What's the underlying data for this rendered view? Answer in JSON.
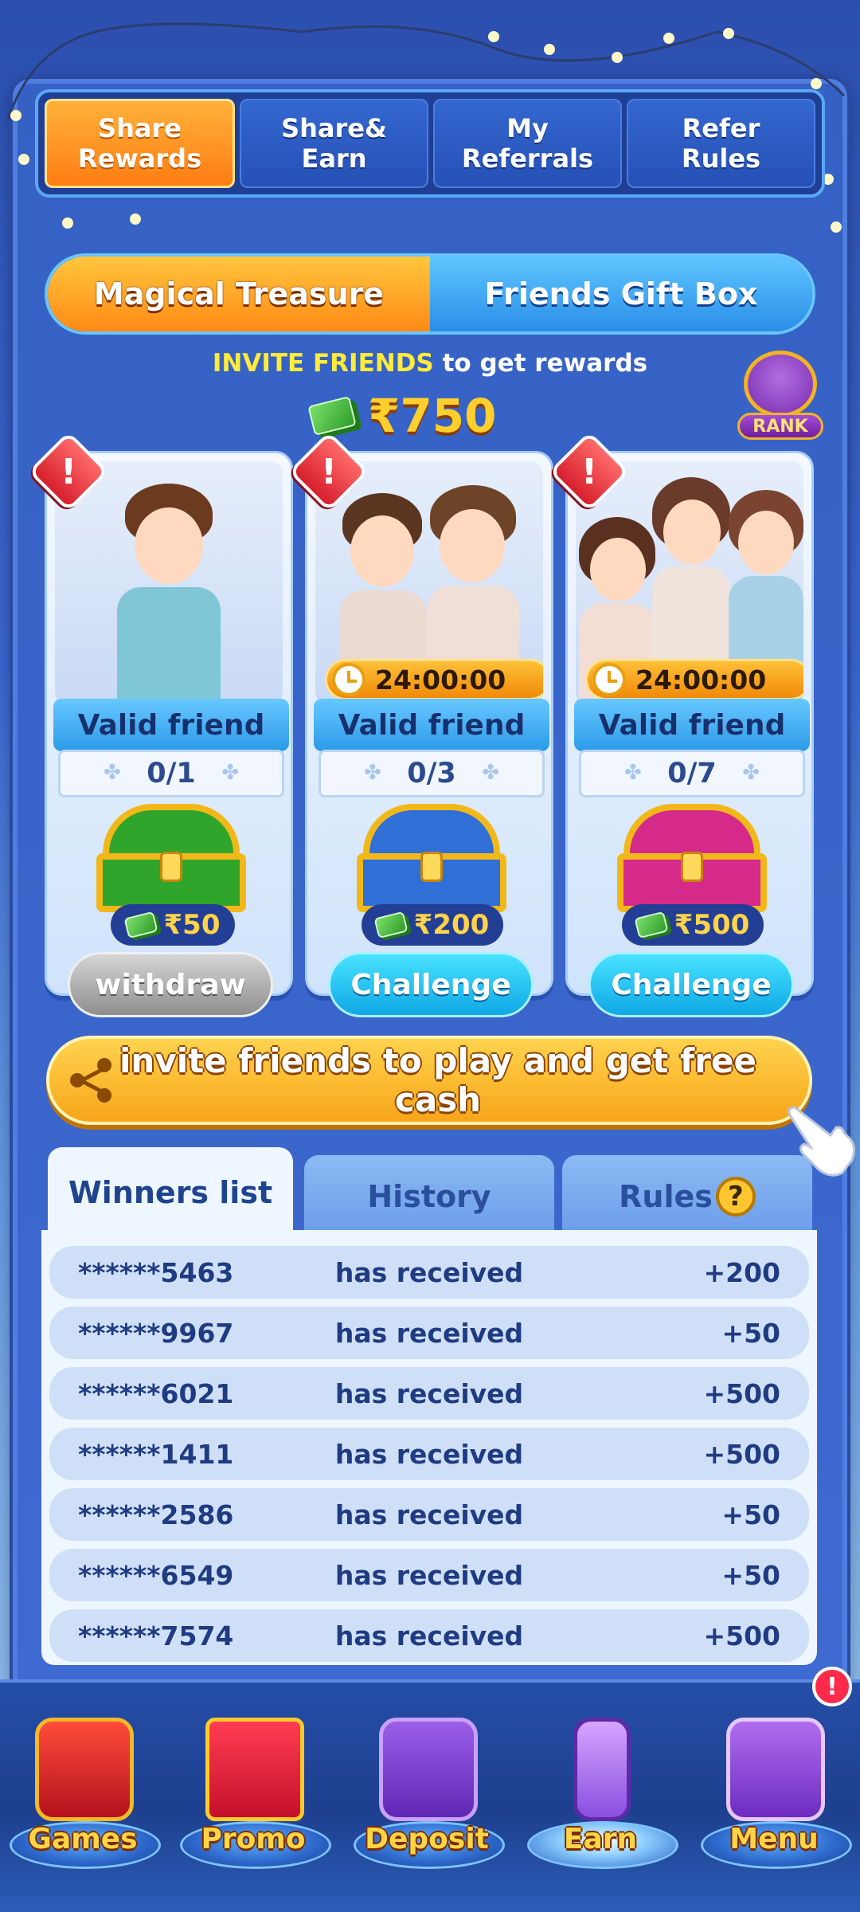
{
  "top_tabs": [
    {
      "label": "Share\nRewards",
      "active": true
    },
    {
      "label": "Share&\nEarn",
      "active": false
    },
    {
      "label": "My\nReferrals",
      "active": false
    },
    {
      "label": "Refer\nRules",
      "active": false
    }
  ],
  "segment": {
    "left": "Magical Treasure",
    "right": "Friends Gift Box",
    "selected": "left"
  },
  "invite": {
    "highlight": "INVITE FRIENDS",
    "rest": "to get  rewards"
  },
  "total_reward": "₹750",
  "rank_label": "RANK",
  "cards": [
    {
      "valid_label": "Valid friend",
      "progress": "0/1",
      "reward": "₹50",
      "button": "withdraw",
      "timer": "",
      "chest_color": "#2fa52b"
    },
    {
      "valid_label": "Valid friend",
      "progress": "0/3",
      "reward": "₹200",
      "button": "Challenge",
      "timer": "24:00:00",
      "chest_color": "#2f6fd6"
    },
    {
      "valid_label": "Valid friend",
      "progress": "0/7",
      "reward": "₹500",
      "button": "Challenge",
      "timer": "24:00:00",
      "chest_color": "#d62a8a"
    }
  ],
  "alert_symbol": "!",
  "banner_text": "invite friends to play and get free cash",
  "list_tabs": {
    "winners": "Winners list",
    "history": "History",
    "rules": "Rules",
    "help_symbol": "?"
  },
  "winners": [
    {
      "user": "******5463",
      "action": "has received",
      "amount": "+200"
    },
    {
      "user": "******9967",
      "action": "has received",
      "amount": "+50"
    },
    {
      "user": "******6021",
      "action": "has received",
      "amount": "+500"
    },
    {
      "user": "******1411",
      "action": "has received",
      "amount": "+500"
    },
    {
      "user": "******2586",
      "action": "has received",
      "amount": "+50"
    },
    {
      "user": "******6549",
      "action": "has received",
      "amount": "+50"
    },
    {
      "user": "******7574",
      "action": "has received",
      "amount": "+500"
    }
  ],
  "bottom_nav": [
    {
      "label": "Games",
      "icon": "slot-machine-icon"
    },
    {
      "label": "Promo",
      "icon": "gift-box-icon"
    },
    {
      "label": "Deposit",
      "icon": "wallet-icon"
    },
    {
      "label": "Earn",
      "icon": "phone-hand-icon"
    },
    {
      "label": "Menu",
      "icon": "menu-book-icon"
    }
  ],
  "nav_badge": "!",
  "colors": {
    "accent_orange": "#ff8a16",
    "accent_cyan": "#2b8ee8",
    "gold": "#ffcf2e",
    "panel_bg": "#eef6ff"
  }
}
